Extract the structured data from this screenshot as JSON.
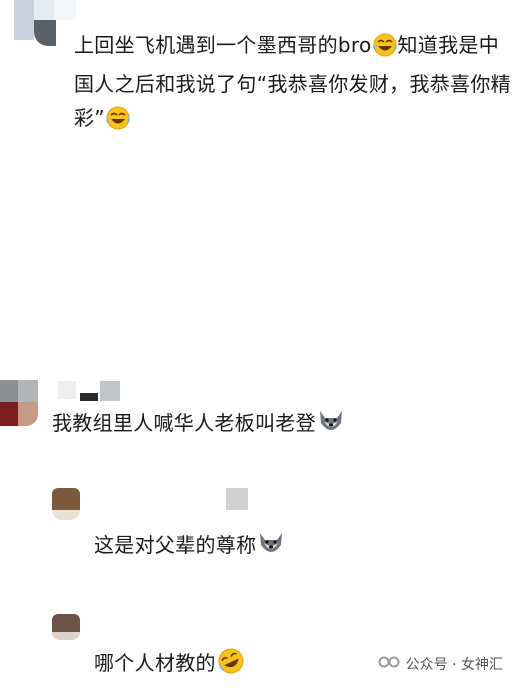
{
  "comments": [
    {
      "text": "上回坐飞机遇到一个墨西哥的bro",
      "text2": "知道我是中国人之后和我说了句“我恭喜你发财，我恭喜你精彩”",
      "line1a": "上回坐飞机遇到一个墨西哥的bro",
      "line1b": "知道我是中",
      "line2": "国人之后和我说了句“我恭喜你发财，我恭喜你精",
      "line3": "彩”"
    },
    {
      "text": "我教组里人喊华人老板叫老登"
    },
    {
      "text": "这是对父辈的尊称"
    },
    {
      "text": "哪个人材教的"
    }
  ],
  "watermark": {
    "label": "公众号 · 女神汇"
  },
  "icons": [
    "laughing-crying-emoji",
    "wolf-emoji",
    "wechat-channel-icon"
  ],
  "colors": {
    "background": "#ffffff",
    "text": "#1a1a1a",
    "watermark": "#555555"
  }
}
